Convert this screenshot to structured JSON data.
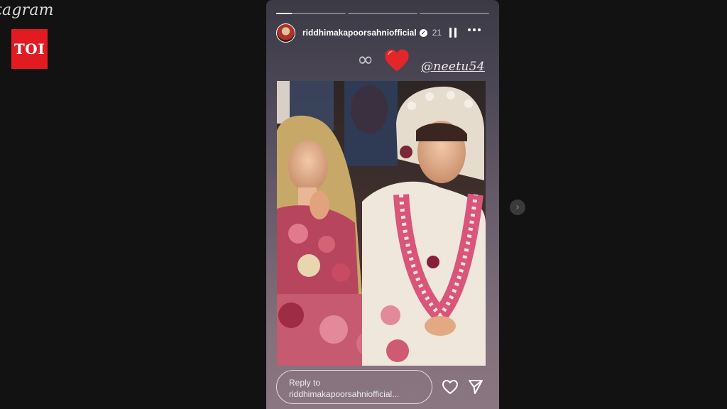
{
  "brand": {
    "wordmark": "tagram",
    "badge": "TOI",
    "badge_color": "#e21b22"
  },
  "story": {
    "progress": [
      0.22,
      0,
      0
    ],
    "username": "riddhimakapoorsahniofficial",
    "time": "21",
    "icons": {
      "avatar": "profile-avatar",
      "verified": "verified-badge-icon",
      "pause": "pause-icon",
      "more": "more-options-icon",
      "infinity": "infinity-emoji",
      "heart": "red-heart-emoji"
    },
    "infinity_glyph": "∞",
    "mention": "@neetu54",
    "photo": "wedding-photo"
  },
  "reply": {
    "line1": "Reply to",
    "line2": "riddhimakapoorsahniofficial..."
  },
  "actions": {
    "like_icon": "heart-outline-icon",
    "send_icon": "paper-plane-icon"
  },
  "nav": {
    "next_glyph": "›",
    "next_icon": "chevron-right-icon"
  },
  "colors": {
    "background": "#121212",
    "heart": "#e3262a"
  }
}
